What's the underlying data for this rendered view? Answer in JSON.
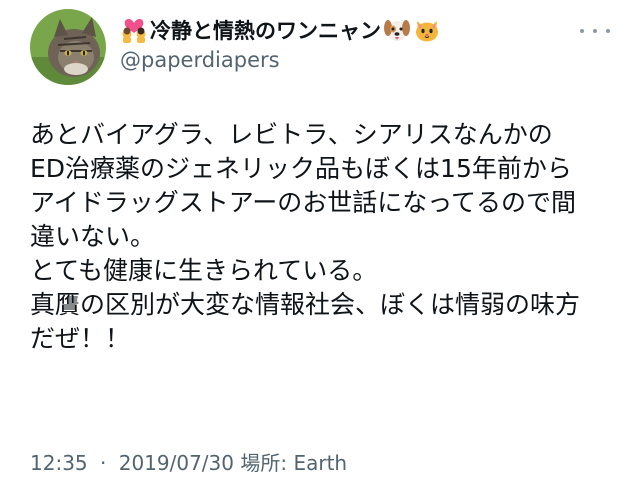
{
  "tweet": {
    "display_name": "冷静と情熱のワンニャン",
    "display_name_prefix_icon": "heart-couple-icon",
    "display_name_suffix_icons": [
      "dog-face-icon",
      "cat-face-icon"
    ],
    "handle": "@paperdiapers",
    "avatar_icon": "cat-avatar",
    "more_icon": "more-options-icon",
    "body_lines": [
      "あとバイアグラ、レビトラ、シアリスなんかの",
      "ED治療薬のジェネリック品もぼくは15年前から",
      "アイドラッグストアーのお世話になってるので間",
      "違いない。",
      "とても健康に生きられている。",
      "真贋の区別が大変な情報社会、ぼくは情弱の味方",
      "だぜ！！"
    ],
    "time": "12:35",
    "separator": "·",
    "date": "2019/07/30",
    "location": "場所: Earth"
  },
  "colors": {
    "text": "#0f1419",
    "secondary": "#536471",
    "background": "#ffffff"
  }
}
